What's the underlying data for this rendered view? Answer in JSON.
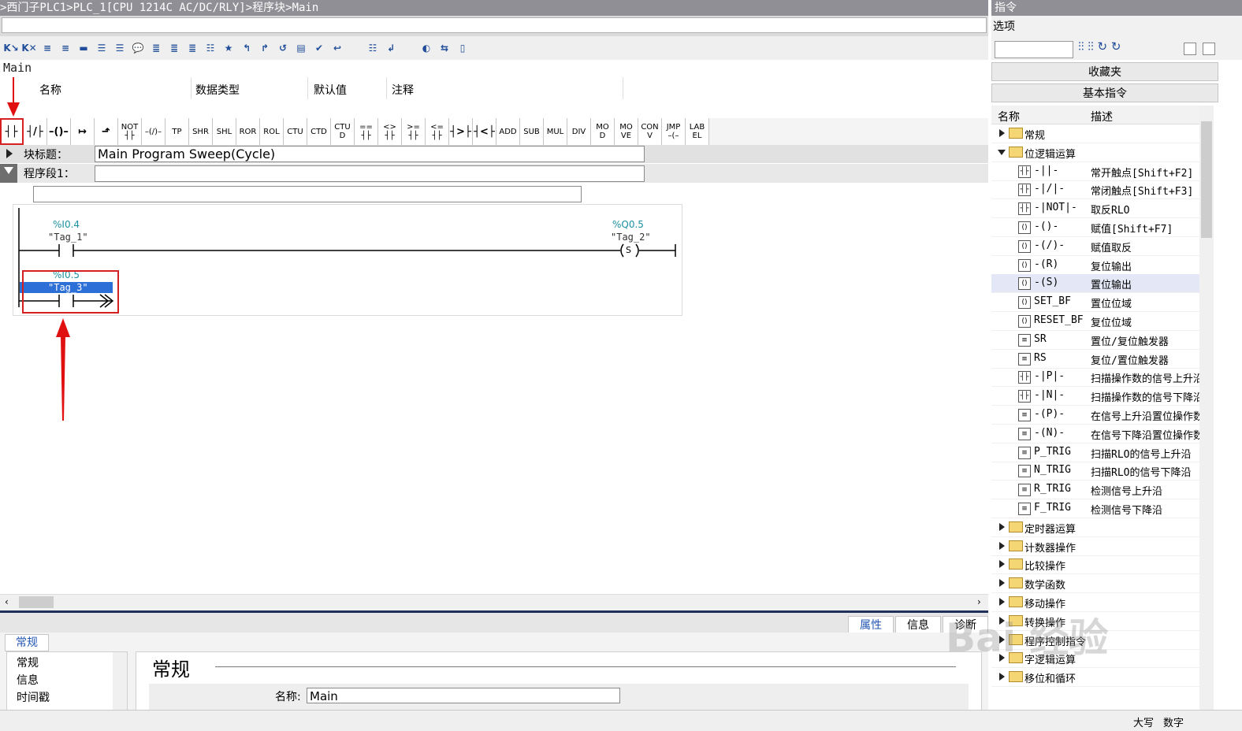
{
  "breadcrumb": ">西门子PLC1>PLC_1[CPU 1214C AC/DC/RLY]>程序块>Main",
  "block_name": "Main",
  "interface_columns": [
    "名称",
    "数据类型",
    "默认值",
    "注释"
  ],
  "ladder_toolbar": [
    {
      "id": "no-contact",
      "label": "┤├",
      "icon": "normally-open-contact-icon",
      "selected": true
    },
    {
      "id": "nc-contact",
      "label": "┤/├",
      "icon": "normally-closed-contact-icon"
    },
    {
      "id": "coil",
      "label": "–()–",
      "icon": "coil-icon"
    },
    {
      "id": "open-branch",
      "label": "↦",
      "icon": "open-branch-icon"
    },
    {
      "id": "close-branch",
      "label": "⬏",
      "icon": "close-branch-icon"
    },
    {
      "id": "not",
      "label": "NOT\n┤├"
    },
    {
      "id": "neg-coil",
      "label": "–(/)–",
      "icon": "negated-coil-icon"
    },
    {
      "id": "tp",
      "label": "TP"
    },
    {
      "id": "shr",
      "label": "SHR"
    },
    {
      "id": "shl",
      "label": "SHL"
    },
    {
      "id": "ror",
      "label": "ROR"
    },
    {
      "id": "rol",
      "label": "ROL"
    },
    {
      "id": "ctu",
      "label": "CTU"
    },
    {
      "id": "ctd",
      "label": "CTD"
    },
    {
      "id": "ctud",
      "label": "CTU\nD"
    },
    {
      "id": "eq",
      "label": "==\n┤├"
    },
    {
      "id": "ne",
      "label": "<>\n┤├"
    },
    {
      "id": "ge",
      "label": ">=\n┤├"
    },
    {
      "id": "le",
      "label": "<=\n┤├"
    },
    {
      "id": "gt",
      "label": "┤>├"
    },
    {
      "id": "lt",
      "label": "┤<├"
    },
    {
      "id": "add",
      "label": "ADD"
    },
    {
      "id": "sub",
      "label": "SUB"
    },
    {
      "id": "mul",
      "label": "MUL"
    },
    {
      "id": "div",
      "label": "DIV"
    },
    {
      "id": "mod",
      "label": "MO\nD"
    },
    {
      "id": "move",
      "label": "MO\nVE"
    },
    {
      "id": "conv",
      "label": "CON\nV"
    },
    {
      "id": "jmp",
      "label": "JMP\n–(–"
    },
    {
      "id": "label",
      "label": "LAB\nEL"
    }
  ],
  "block_title": {
    "label": "块标题：",
    "value": "Main Program Sweep(Cycle)"
  },
  "network": {
    "label": "程序段1：",
    "title_value": "",
    "comment_value": ""
  },
  "rung1": {
    "contact": {
      "address": "%I0.4",
      "tag": "\"Tag_1\""
    },
    "coil": {
      "address": "%Q0.5",
      "tag": "\"Tag_2\"",
      "symbol": "S"
    }
  },
  "rung2": {
    "contact": {
      "address": "%I0.5",
      "tag": "\"Tag_3\""
    }
  },
  "properties": {
    "tabs": [
      "属性",
      "信息",
      "诊断"
    ],
    "active_tab": "属性",
    "sub_tab": "常规",
    "nav": [
      "常规",
      "信息",
      "时间戳"
    ],
    "section_title": "常规",
    "name_label": "名称:",
    "name_value": "Main"
  },
  "status": {
    "caps": "大写",
    "num": "数字"
  },
  "right_panel": {
    "title": "指令",
    "options_label": "选项",
    "search_value": "",
    "favorites": "收藏夹",
    "basic": "基本指令",
    "columns": [
      "名称",
      "描述"
    ],
    "tree": [
      {
        "type": "folder",
        "name": "常规",
        "expanded": false
      },
      {
        "type": "folder",
        "name": "位逻辑运算",
        "expanded": true
      },
      {
        "type": "item",
        "icon": "┤├",
        "name": "-||-",
        "desc": "常开触点[Shift+F2]"
      },
      {
        "type": "item",
        "icon": "┤├",
        "name": "-|/|-",
        "desc": "常闭触点[Shift+F3]"
      },
      {
        "type": "item",
        "icon": "┤├",
        "name": "-|NOT|-",
        "desc": "取反RLO"
      },
      {
        "type": "item",
        "icon": "()",
        "name": "-()-",
        "desc": "赋值[Shift+F7]"
      },
      {
        "type": "item",
        "icon": "()",
        "name": "-(/)-",
        "desc": "赋值取反"
      },
      {
        "type": "item",
        "icon": "()",
        "name": "-(R)",
        "desc": "复位输出"
      },
      {
        "type": "item",
        "icon": "()",
        "name": "-(S)",
        "desc": "置位输出",
        "highlight": true
      },
      {
        "type": "item",
        "icon": "()",
        "name": "SET_BF",
        "desc": "置位位域"
      },
      {
        "type": "item",
        "icon": "()",
        "name": "RESET_BF",
        "desc": "复位位域"
      },
      {
        "type": "item",
        "icon": "≡",
        "name": "SR",
        "desc": "置位/复位触发器"
      },
      {
        "type": "item",
        "icon": "≡",
        "name": "RS",
        "desc": "复位/置位触发器"
      },
      {
        "type": "item",
        "icon": "┤├",
        "name": "-|P|-",
        "desc": "扫描操作数的信号上升沿"
      },
      {
        "type": "item",
        "icon": "┤├",
        "name": "-|N|-",
        "desc": "扫描操作数的信号下降沿"
      },
      {
        "type": "item",
        "icon": "≡",
        "name": "-(P)-",
        "desc": "在信号上升沿置位操作数"
      },
      {
        "type": "item",
        "icon": "≡",
        "name": "-(N)-",
        "desc": "在信号下降沿置位操作数"
      },
      {
        "type": "item",
        "icon": "≡",
        "name": "P_TRIG",
        "desc": "扫描RLO的信号上升沿"
      },
      {
        "type": "item",
        "icon": "≡",
        "name": "N_TRIG",
        "desc": "扫描RLO的信号下降沿"
      },
      {
        "type": "item",
        "icon": "≡",
        "name": "R_TRIG",
        "desc": "检测信号上升沿"
      },
      {
        "type": "item",
        "icon": "≡",
        "name": "F_TRIG",
        "desc": "检测信号下降沿"
      },
      {
        "type": "folder",
        "name": "定时器运算",
        "expanded": false
      },
      {
        "type": "folder",
        "name": "计数器操作",
        "expanded": false
      },
      {
        "type": "folder",
        "name": "比较操作",
        "expanded": false
      },
      {
        "type": "folder",
        "name": "数学函数",
        "expanded": false
      },
      {
        "type": "folder",
        "name": "移动操作",
        "expanded": false
      },
      {
        "type": "folder",
        "name": "转换操作",
        "expanded": false
      },
      {
        "type": "folder",
        "name": "程序控制指令",
        "expanded": false
      },
      {
        "type": "folder",
        "name": "字逻辑运算",
        "expanded": false
      },
      {
        "type": "folder",
        "name": "移位和循环",
        "expanded": false
      }
    ]
  },
  "watermark": "Bai 经验"
}
